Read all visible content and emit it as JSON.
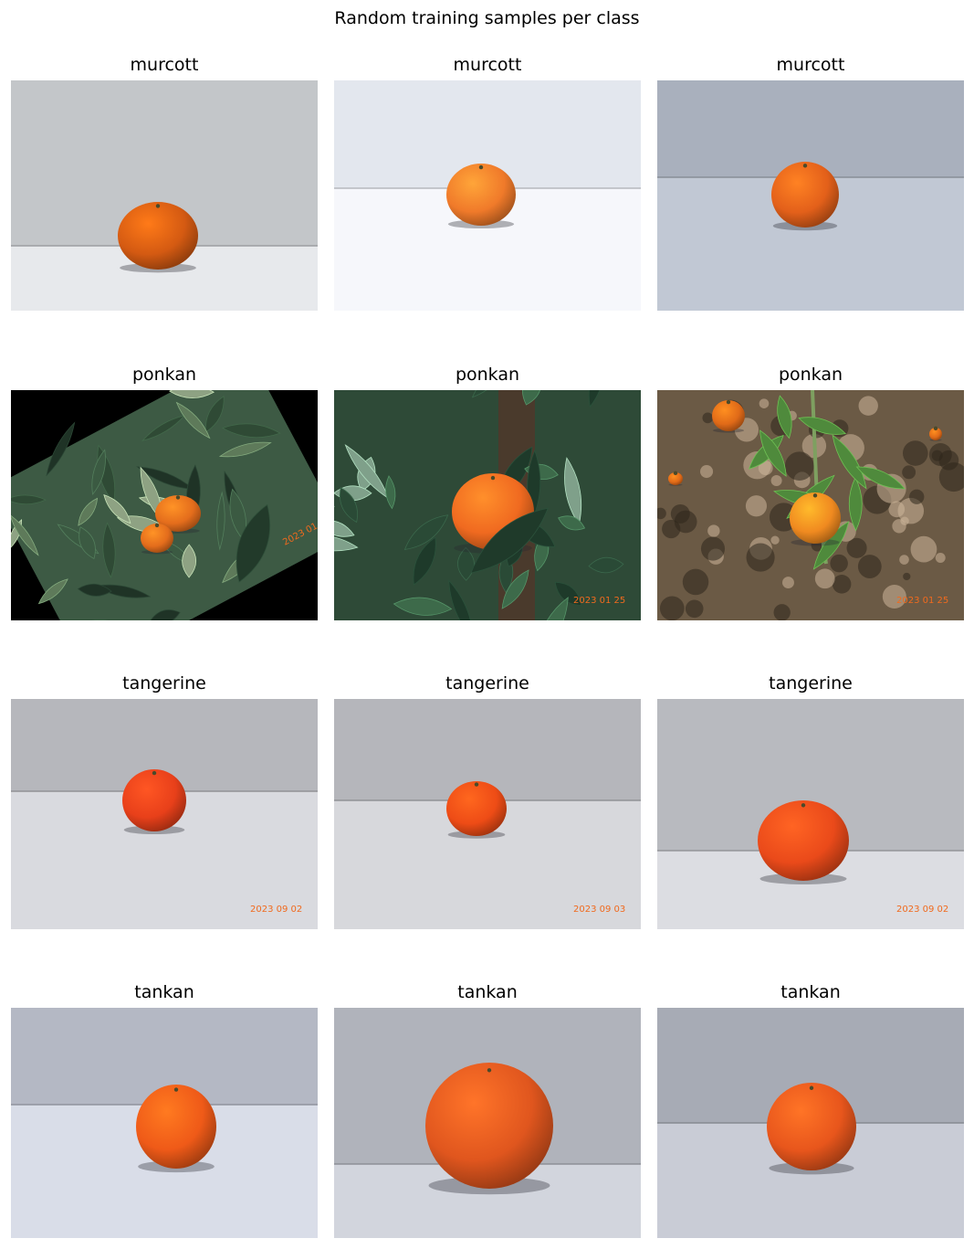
{
  "figure": {
    "title": "Random training samples per class"
  },
  "rows": [
    {
      "cells": [
        {
          "label": "murcott",
          "scene": "studio",
          "bg": "#c3c6c9",
          "table": "#e7e9ec",
          "horizon": 0.72,
          "fruit_color": "#d45a12",
          "stamp": ""
        },
        {
          "label": "murcott",
          "scene": "studio",
          "bg": "#e3e7ee",
          "table": "#f6f7fb",
          "horizon": 0.47,
          "fruit_color": "#f07a2a",
          "stamp": ""
        },
        {
          "label": "murcott",
          "scene": "studio",
          "bg": "#a9b0bd",
          "table": "#c1c8d4",
          "horizon": 0.42,
          "fruit_color": "#e3601a",
          "stamp": ""
        }
      ]
    },
    {
      "cells": [
        {
          "label": "ponkan",
          "scene": "foliage-rotated",
          "bg": "#3d5a44",
          "fruit_color": "#e46d1c",
          "stamp": "2023  01"
        },
        {
          "label": "ponkan",
          "scene": "foliage",
          "bg": "#2e4a37",
          "fruit_color": "#f06a20",
          "stamp": "2023  01  25"
        },
        {
          "label": "ponkan",
          "scene": "ground",
          "bg": "#6b5a45",
          "fruit_color": "#f08a20",
          "stamp": "2023  01  25"
        }
      ]
    },
    {
      "cells": [
        {
          "label": "tangerine",
          "scene": "studio",
          "bg": "#b6b7bc",
          "table": "#d9dadf",
          "horizon": 0.4,
          "fruit_color": "#e8401a",
          "stamp": "2023  09  02"
        },
        {
          "label": "tangerine",
          "scene": "studio",
          "bg": "#b5b6bb",
          "table": "#d7d8dc",
          "horizon": 0.44,
          "fruit_color": "#ee4c16",
          "stamp": "2023  09  03"
        },
        {
          "label": "tangerine",
          "scene": "studio",
          "bg": "#b8babf",
          "table": "#dcdde2",
          "horizon": 0.66,
          "fruit_color": "#ea4a1a",
          "stamp": "2023  09  02"
        }
      ]
    },
    {
      "cells": [
        {
          "label": "tankan",
          "scene": "studio",
          "bg": "#b4b8c4",
          "table": "#d9dde8",
          "horizon": 0.42,
          "fruit_color": "#ef5a18",
          "stamp": ""
        },
        {
          "label": "tankan",
          "scene": "studio",
          "bg": "#b0b3bb",
          "table": "#d2d5dd",
          "horizon": 0.68,
          "fruit_color": "#e0561e",
          "stamp": ""
        },
        {
          "label": "tankan",
          "scene": "studio",
          "bg": "#a7abb5",
          "table": "#c9ccd6",
          "horizon": 0.5,
          "fruit_color": "#e8561c",
          "stamp": ""
        }
      ]
    }
  ]
}
